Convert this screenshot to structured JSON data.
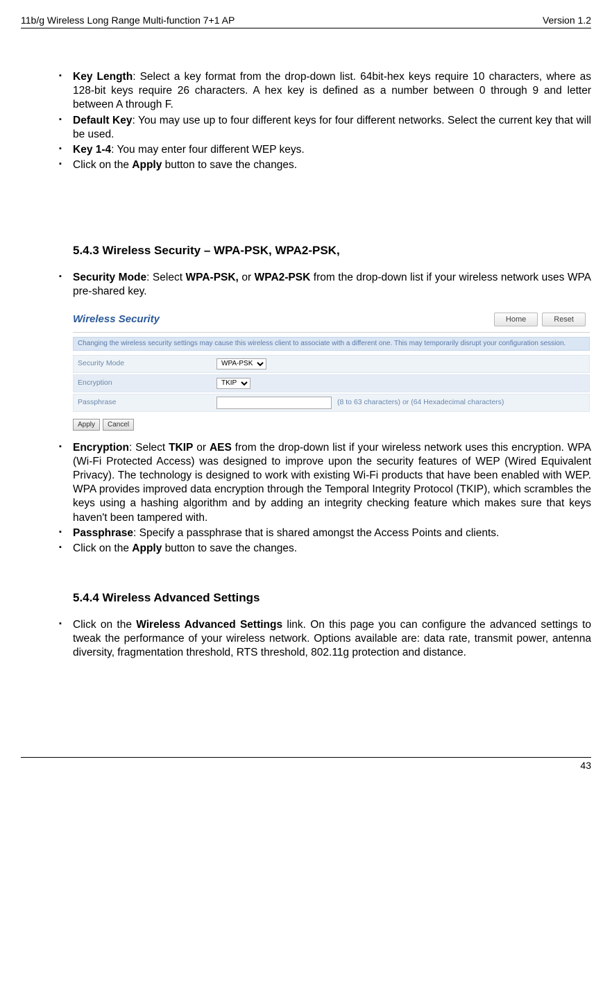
{
  "header": {
    "left": "11b/g Wireless Long Range Multi-function 7+1 AP",
    "right": "Version 1.2"
  },
  "bullets1": {
    "keyLength": {
      "label": "Key Length",
      "text": ": Select a key format from the drop-down list. 64bit-hex keys require 10 characters, where as 128-bit keys require 26 characters. A hex key is defined as a number between 0 through 9 and letter between A through F."
    },
    "defaultKey": {
      "label": "Default Key",
      "text": ": You may use up to four different keys for four different networks. Select the current key that will be used."
    },
    "key14": {
      "label": "Key 1-4",
      "text": ": You may enter four different WEP keys."
    },
    "apply": {
      "pre": "Click on the ",
      "bold": "Apply",
      "post": " button to save the changes."
    }
  },
  "section543": "5.4.3   Wireless Security – WPA-PSK, WPA2-PSK,",
  "secMode": {
    "label": "Security Mode",
    "pre": ": Select ",
    "b1": "WPA-PSK,",
    "mid": " or ",
    "b2": "WPA2-PSK",
    "post": " from the drop-down list if your wireless network uses WPA pre-shared key."
  },
  "shot": {
    "title": "Wireless Security",
    "homeBtn": "Home",
    "resetBtn": "Reset",
    "note": "Changing the wireless security settings may cause this wireless client to associate with a different one. This may temporarily disrupt your configuration session.",
    "rows": {
      "secMode": {
        "label": "Security Mode",
        "value": "WPA-PSK"
      },
      "encryption": {
        "label": "Encryption",
        "value": "TKIP"
      },
      "passphrase": {
        "label": "Passphrase",
        "value": "",
        "hint": "(8 to 63 characters) or (64 Hexadecimal characters)"
      }
    },
    "applyBtn": "Apply",
    "cancelBtn": "Cancel"
  },
  "bullets2": {
    "encryption": {
      "label": "Encryption",
      "pre": ": Select ",
      "b1": "TKIP",
      "mid": " or ",
      "b2": "AES",
      "post": " from the drop-down list if your wireless network uses this encryption. WPA (Wi-Fi Protected Access) was designed to improve upon the security features of WEP (Wired Equivalent Privacy). The technology is designed to work with existing Wi-Fi products that have been enabled with WEP. WPA provides improved data encryption through the Temporal Integrity Protocol (TKIP), which scrambles the keys using a hashing algorithm and by adding an integrity checking feature which makes sure that keys haven't been tampered with."
    },
    "passphrase": {
      "label": "Passphrase",
      "text": ": Specify a passphrase that is shared amongst the Access Points and clients."
    },
    "apply": {
      "pre": "Click on the ",
      "bold": "Apply",
      "post": " button to save the changes."
    }
  },
  "section544": "5.4.4   Wireless Advanced Settings",
  "bullets3": {
    "adv": {
      "pre": "Click on the ",
      "bold": "Wireless Advanced Settings",
      "post": " link. On this page you can configure the advanced settings to tweak the performance of your wireless network. Options available are: data rate, transmit power, antenna diversity, fragmentation threshold, RTS threshold, 802.11g protection and distance."
    }
  },
  "footer": "43"
}
